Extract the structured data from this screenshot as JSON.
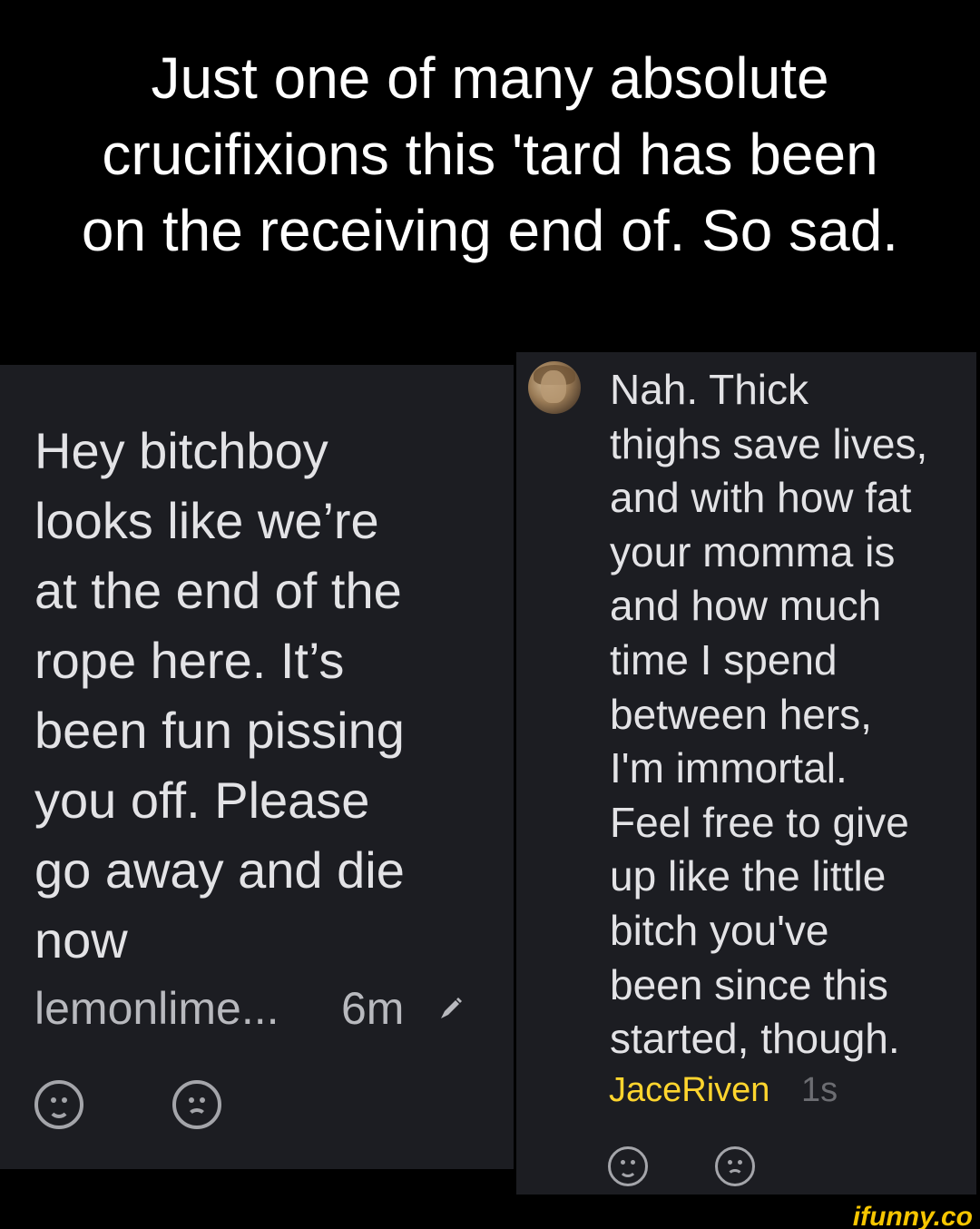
{
  "caption": {
    "lines": [
      "Just one of many absolute",
      "crucifixions this 'tard has been",
      "on the receiving end of. So sad."
    ]
  },
  "left_comment": {
    "lines": [
      "Hey bitchboy",
      "looks like we’re",
      "at the end of the",
      "rope here. It’s",
      "been fun pissing",
      "you off. Please",
      "go away and die",
      "now"
    ],
    "username": "lemonlime...",
    "time": "6m",
    "icons": [
      "edit-icon",
      "smile-icon",
      "frown-icon"
    ]
  },
  "right_comment": {
    "lines": [
      "Nah. Thick",
      "thighs save lives,",
      "and with how fat",
      "your momma is",
      "and how much",
      "time I spend",
      "between hers,",
      "I'm immortal.",
      "Feel free to give",
      "up like the little",
      "bitch you've",
      "been since this",
      "started, though."
    ],
    "username": "JaceRiven",
    "time": "1s",
    "icons": [
      "avatar",
      "smile-icon",
      "frown-icon"
    ]
  },
  "watermark": "ifunny.co",
  "colors": {
    "background": "#000000",
    "panel": "#1c1d22",
    "comment_text": "#e3e3e6",
    "username_highlight": "#ffd52e",
    "watermark": "#f7c600"
  }
}
